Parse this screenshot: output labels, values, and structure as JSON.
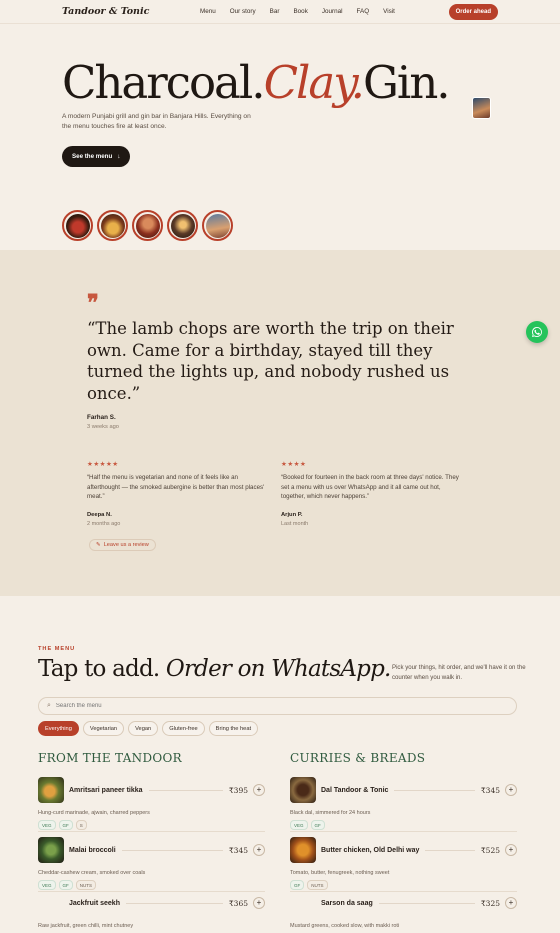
{
  "nav": {
    "brand": "Tandoor & Tonic",
    "links": [
      "Menu",
      "Our story",
      "Bar",
      "Book",
      "Journal",
      "FAQ",
      "Visit"
    ],
    "cta": "Order ahead"
  },
  "hero": {
    "title_part1": "Charcoal.",
    "title_accent": "Clay.",
    "title_part2": "Gin.",
    "subtitle": "A modern Punjabi grill and gin bar in Banjara Hills. Everything on the menu touches fire at least once.",
    "button_label": "See the menu",
    "button_icon": "arrow-down-icon"
  },
  "testimonial": {
    "quote_icon": "quote-icon",
    "quote": "“The lamb chops are worth the trip on their own. Came for a birthday, stayed till they turned the lights up, and nobody rushed us once.”",
    "author": "Farhan S.",
    "when": "3 weeks ago",
    "reviews": [
      {
        "stars": "★★★★★",
        "text": "“Half the menu is vegetarian and none of it feels like an afterthought — the smoked aubergine is better than most places' meat.”",
        "author": "Deepa N.",
        "when": "2 months ago"
      },
      {
        "stars": "★★★★",
        "text": "“Booked for fourteen in the back room at three days' notice. They set a menu with us over WhatsApp and it all came out hot, together, which never happens.”",
        "author": "Arjun P.",
        "when": "Last month"
      }
    ],
    "leave_review": "Leave us a review"
  },
  "menu": {
    "eyebrow": "THE MENU",
    "title_plain": "Tap to add.",
    "title_italic": "Order on WhatsApp.",
    "note": "Pick your things, hit order, and we'll have it on the counter when you walk in.",
    "search_placeholder": "Search the menu",
    "filters": [
      "Everything",
      "Vegetarian",
      "Vegan",
      "Gluten-free",
      "Bring the heat"
    ],
    "tandoor": {
      "heading": "FROM THE TANDOOR",
      "items": [
        {
          "name": "Amritsari paneer tikka",
          "price": "₹395",
          "desc": "Hung-curd marinade, ajwain, charred peppers",
          "tags": [
            "VEG",
            "GF",
            "S"
          ]
        },
        {
          "name": "Malai broccoli",
          "price": "₹345",
          "desc": "Cheddar-cashew cream, smoked over coals",
          "tags": [
            "VEG",
            "GF",
            "NUTS"
          ]
        },
        {
          "name": "Jackfruit seekh",
          "price": "₹365",
          "desc": "Raw jackfruit, green chilli, mint chutney",
          "tags": []
        }
      ]
    },
    "curries": {
      "heading": "CURRIES & BREADS",
      "items": [
        {
          "name": "Dal Tandoor & Tonic",
          "price": "₹345",
          "desc": "Black dal, simmered for 24 hours",
          "tags": [
            "VEG",
            "GF"
          ]
        },
        {
          "name": "Butter chicken, Old Delhi way",
          "price": "₹525",
          "desc": "Tomato, butter, fenugreek, nothing sweet",
          "tags": [
            "GF",
            "NUTS"
          ]
        },
        {
          "name": "Sarson da saag",
          "price": "₹325",
          "desc": "Mustard greens, cooked slow, with makki roti",
          "tags": []
        }
      ]
    }
  },
  "colors": {
    "accent": "#b8402a",
    "section": "#2f5a3e",
    "band": "#ebe2d3",
    "bg": "#f5efe7",
    "whatsapp": "#25c35b"
  }
}
